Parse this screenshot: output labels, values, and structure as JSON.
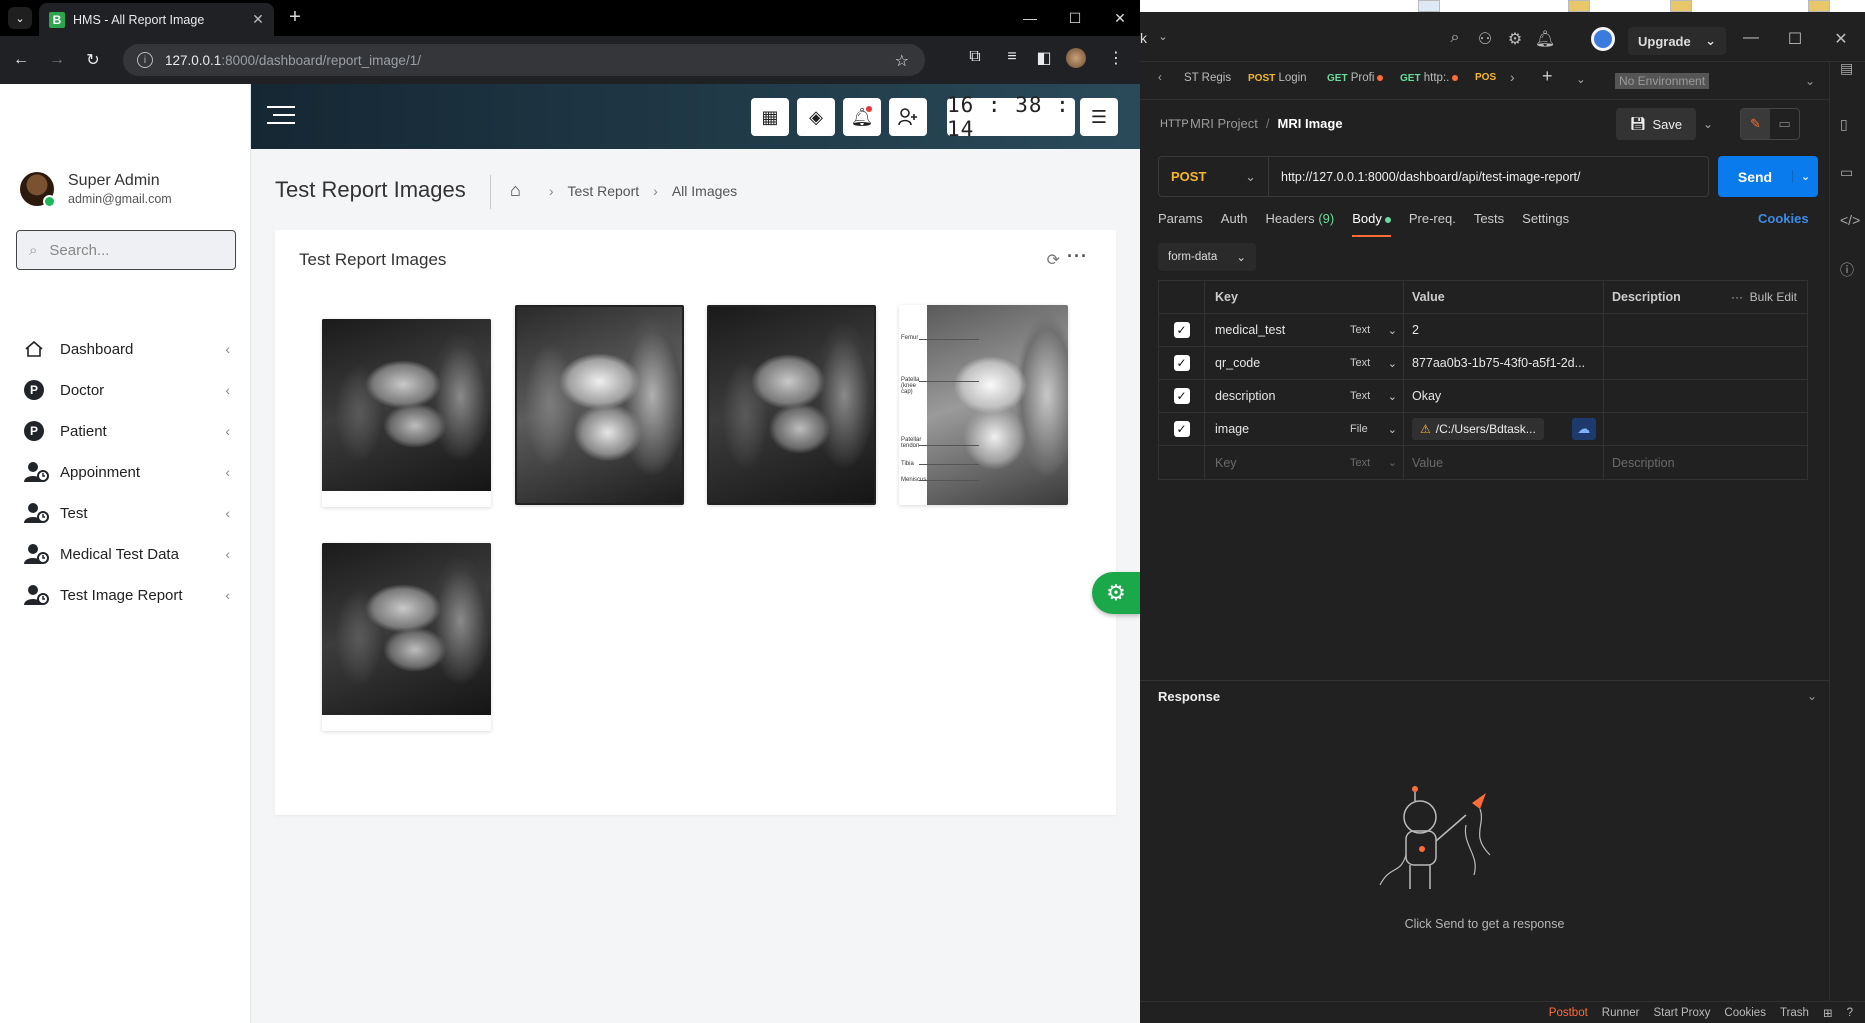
{
  "chrome": {
    "tab_title": "HMS - All Report Image",
    "favicon_letter": "B",
    "url_host": "127.0.0.1",
    "url_path": ":8000/dashboard/report_image/1/"
  },
  "hms": {
    "user": {
      "name": "Super Admin",
      "email": "admin@gmail.com"
    },
    "search_placeholder": "Search...",
    "menu": [
      {
        "label": "Dashboard",
        "icon": "home-icon"
      },
      {
        "label": "Doctor",
        "icon": "p-badge-icon"
      },
      {
        "label": "Patient",
        "icon": "p-badge-icon"
      },
      {
        "label": "Appoinment",
        "icon": "user-clock-icon"
      },
      {
        "label": "Test",
        "icon": "user-clock-icon"
      },
      {
        "label": "Medical Test Data",
        "icon": "user-clock-icon"
      },
      {
        "label": "Test Image Report",
        "icon": "user-clock-icon"
      }
    ],
    "clock": "16 : 38 : 14",
    "page_title": "Test Report Images",
    "breadcrumb": [
      "Test Report",
      "All Images"
    ],
    "card_title": "Test Report Images",
    "mri_labels": [
      "Femur",
      "Patella (knee cap)",
      "Patellar tendon",
      "Tibia",
      "Meniscus"
    ]
  },
  "postman": {
    "title_fragment": "k",
    "upgrade_label": "Upgrade",
    "tabs": [
      {
        "method": "",
        "label": "ST Regis",
        "unsaved": false
      },
      {
        "method": "POST",
        "label": "Login",
        "unsaved": false
      },
      {
        "method": "GET",
        "label": "Profi",
        "unsaved": true
      },
      {
        "method": "GET",
        "label": "http:.",
        "unsaved": true
      },
      {
        "method": "",
        "label": "POS",
        "unsaved": false
      }
    ],
    "environment": "No Environment",
    "breadcrumb": {
      "project": "MRI Project",
      "request": "MRI Image"
    },
    "save_label": "Save",
    "method": "POST",
    "url": "http://127.0.0.1:8000/dashboard/api/test-image-report/",
    "send_label": "Send",
    "request_tabs": [
      "Params",
      "Auth",
      "Headers",
      "Body",
      "Pre-req.",
      "Tests",
      "Settings"
    ],
    "headers_count": "(9)",
    "cookies_label": "Cookies",
    "body_type": "form-data",
    "table": {
      "headers": {
        "key": "Key",
        "value": "Value",
        "description": "Description",
        "bulk_edit": "Bulk Edit"
      },
      "rows": [
        {
          "key": "medical_test",
          "type": "Text",
          "value": "2"
        },
        {
          "key": "qr_code",
          "type": "Text",
          "value": "877aa0b3-1b75-43f0-a5f1-2d..."
        },
        {
          "key": "description",
          "type": "Text",
          "value": "Okay"
        },
        {
          "key": "image",
          "type": "File",
          "value": "/C:/Users/Bdtask..."
        }
      ],
      "placeholder": {
        "key": "Key",
        "type": "Text",
        "value": "Value",
        "description": "Description"
      }
    },
    "response_title": "Response",
    "response_hint": "Click Send to get a response",
    "footer": [
      "Postbot",
      "Runner",
      "Start Proxy",
      "Cookies",
      "Trash"
    ]
  },
  "colors": {
    "hms_header_from": "#152733",
    "hms_header_to": "#2a4a5a",
    "hms_float_gear": "#1aa84a",
    "postman_send": "#097bed",
    "postman_accent": "#ff6c37"
  }
}
